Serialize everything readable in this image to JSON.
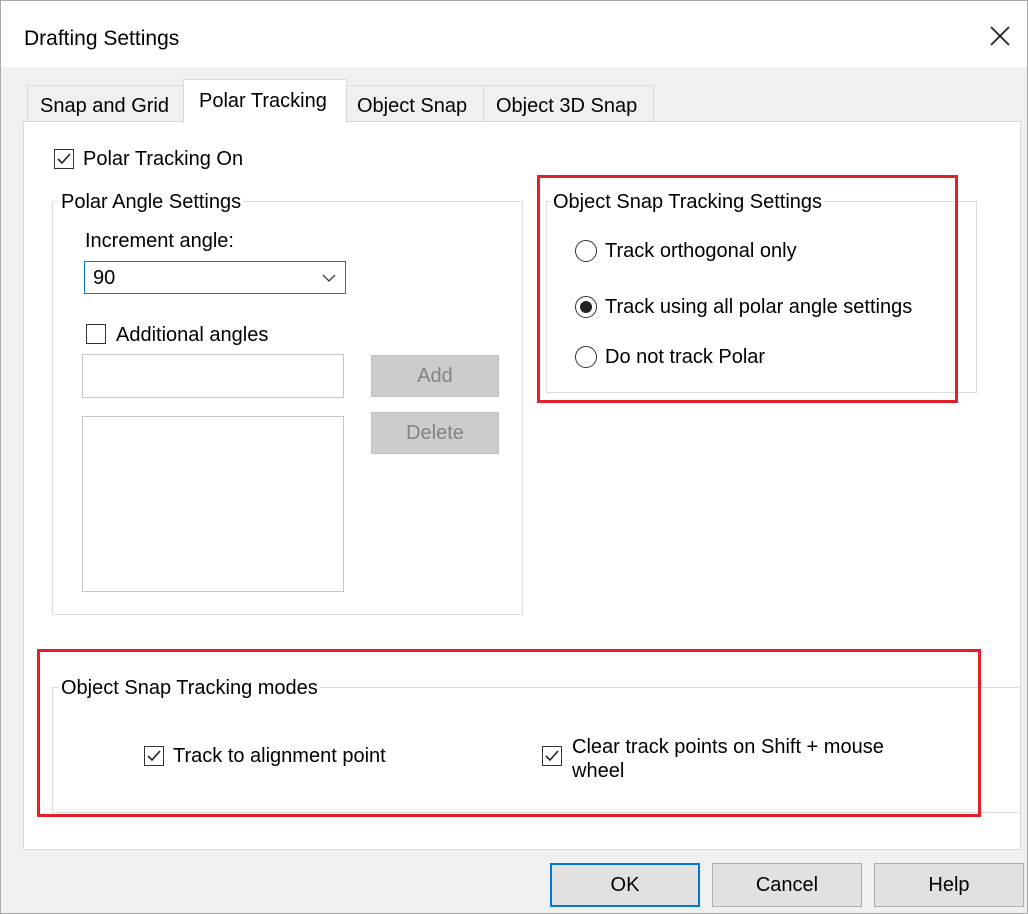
{
  "window": {
    "title": "Drafting Settings"
  },
  "tabs": [
    {
      "label": "Snap and Grid"
    },
    {
      "label": "Polar Tracking"
    },
    {
      "label": "Object Snap"
    },
    {
      "label": "Object 3D Snap"
    }
  ],
  "polar": {
    "tracking_on_label": "Polar Tracking On",
    "tracking_on_checked": true,
    "angle_group_title": "Polar Angle Settings",
    "increment_label": "Increment angle:",
    "increment_value": "90",
    "additional_label": "Additional angles",
    "additional_checked": false,
    "add_label": "Add",
    "delete_label": "Delete"
  },
  "snap_tracking": {
    "group_title": "Object Snap Tracking Settings",
    "options": [
      {
        "label": "Track orthogonal only",
        "selected": false
      },
      {
        "label": "Track using all polar angle settings",
        "selected": true
      },
      {
        "label": "Do not track Polar",
        "selected": false
      }
    ]
  },
  "modes": {
    "group_title": "Object Snap Tracking modes",
    "align_label": "Track to alignment point",
    "align_checked": true,
    "clear_label_line1": "Clear track points on Shift + mouse",
    "clear_label_line2": "wheel",
    "clear_checked": true
  },
  "buttons": {
    "ok": "OK",
    "cancel": "Cancel",
    "help": "Help"
  },
  "colors": {
    "highlight": "#e32028",
    "focus": "#0078d7"
  }
}
